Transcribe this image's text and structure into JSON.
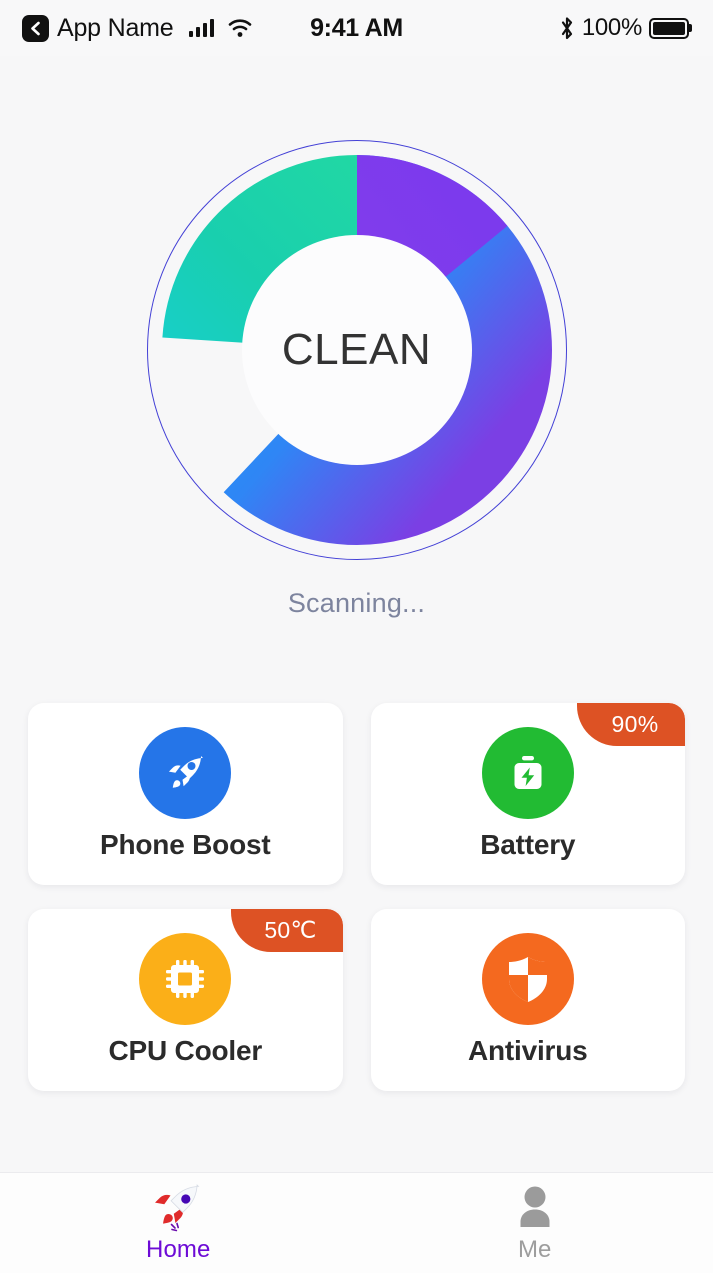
{
  "status_bar": {
    "back_icon": "back-chevron-icon",
    "app_name": "App Name",
    "signal_icon": "cellular-signal-icon",
    "wifi_icon": "wifi-icon",
    "time": "9:41 AM",
    "bluetooth_icon": "bluetooth-icon",
    "battery_percent": "100%",
    "battery_icon": "battery-full-icon"
  },
  "scanner": {
    "center_label": "CLEAN",
    "status_text": "Scanning...",
    "outer_ring_color": "#4340d6",
    "segments": [
      {
        "name": "main",
        "percent": 62,
        "color_start": "#2196f3",
        "color_end": "#7b3fe4"
      },
      {
        "name": "green",
        "percent": 24,
        "color_start": "#18cfa0",
        "color_end": "#2bd6a0"
      },
      {
        "name": "purple",
        "percent": 14,
        "color_start": "#7c3aed",
        "color_end": "#8a42ea"
      }
    ]
  },
  "features": [
    {
      "label": "Phone Boost",
      "icon": "rocket-icon",
      "icon_bg": "#2575e8",
      "badge": null
    },
    {
      "label": "Battery",
      "icon": "battery-charging-icon",
      "icon_bg": "#22bb33",
      "badge": "90%",
      "badge_color": "#dd5224"
    },
    {
      "label": "CPU Cooler",
      "icon": "cpu-chip-icon",
      "icon_bg": "#fbaf18",
      "badge": "50℃",
      "badge_color": "#dd5224"
    },
    {
      "label": "Antivirus",
      "icon": "shield-icon",
      "icon_bg": "#f4691f",
      "badge": null
    }
  ],
  "tabbar": {
    "tabs": [
      {
        "label": "Home",
        "icon": "rocket-emoji-icon",
        "active": true,
        "color": "#6d0bd6"
      },
      {
        "label": "Me",
        "icon": "person-icon",
        "active": false,
        "color": "#9d9d9d"
      }
    ]
  }
}
